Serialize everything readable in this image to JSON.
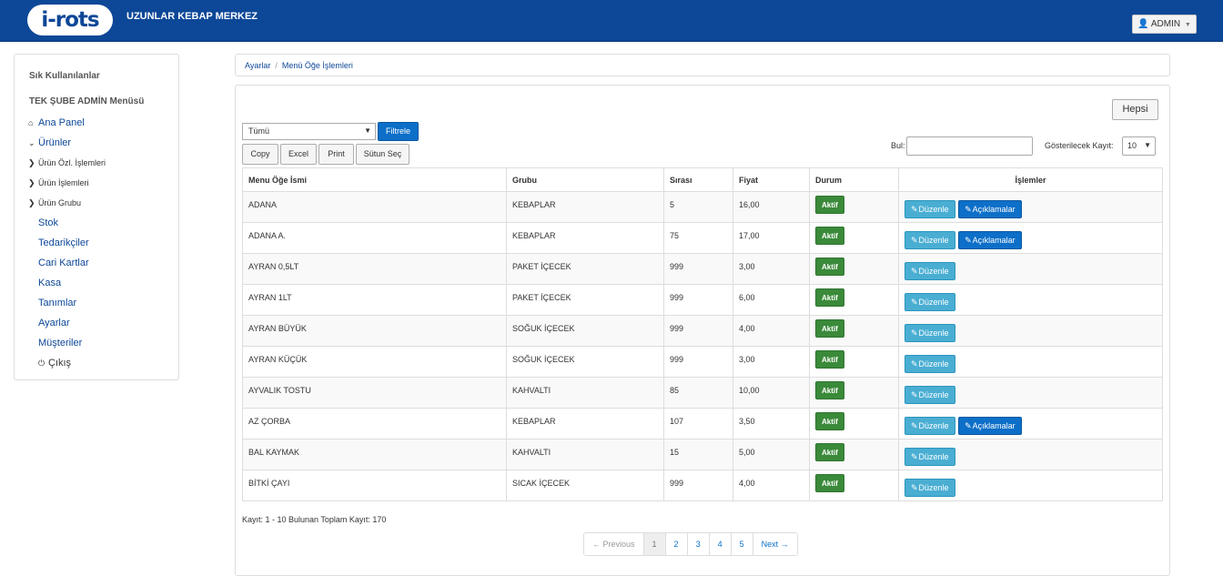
{
  "header": {
    "logo_text": "i-rots",
    "brand": "UZUNLAR KEBAP MERKEZ",
    "user": "ADMIN"
  },
  "sidebar": {
    "section1": "Sık Kullanılanlar",
    "section2": "TEK ŞUBE ADMİN Menüsü",
    "items": [
      {
        "label": "Ana Panel",
        "icon": "home-icon"
      },
      {
        "label": "Ürünler",
        "icon": "chevron-down-icon"
      },
      {
        "label": "Ürün Özl. İşlemleri",
        "icon": "chevron-right-icon"
      },
      {
        "label": "Ürün İşlemleri",
        "icon": "chevron-right-icon"
      },
      {
        "label": "Ürün Grubu",
        "icon": "chevron-right-icon"
      },
      {
        "label": "Stok"
      },
      {
        "label": "Tedarikçiler"
      },
      {
        "label": "Cari Kartlar"
      },
      {
        "label": "Kasa"
      },
      {
        "label": "Tanımlar"
      },
      {
        "label": "Ayarlar"
      },
      {
        "label": "Müşteriler"
      },
      {
        "label": "Çıkış",
        "icon": "power-icon"
      }
    ]
  },
  "breadcrumb": {
    "parent": "Ayarlar",
    "current": "Menü Öğe İşlemleri"
  },
  "toolbar": {
    "all_button": "Hepsi",
    "filter_select": "Tümü",
    "filter_button": "Filtrele",
    "copy": "Copy",
    "excel": "Excel",
    "print": "Print",
    "columns": "Sütun Seç",
    "search_label": "Bul:",
    "search_value": "",
    "show_label": "Gösterilecek Kayıt:",
    "show_value": "10"
  },
  "table": {
    "columns": [
      "Menu Öğe İsmi",
      "Grubu",
      "Sırası",
      "Fiyat",
      "Durum",
      "İşlemler"
    ],
    "edit_label": "Düzenle",
    "desc_label": "Açıklamalar",
    "rows": [
      {
        "name": "ADANA",
        "group": "KEBAPLAR",
        "order": "5",
        "price": "16,00",
        "status": "Aktif",
        "has_desc": true
      },
      {
        "name": "ADANA A.",
        "group": "KEBAPLAR",
        "order": "75",
        "price": "17,00",
        "status": "Aktif",
        "has_desc": true
      },
      {
        "name": "AYRAN 0,5LT",
        "group": "PAKET İÇECEK",
        "order": "999",
        "price": "3,00",
        "status": "Aktif",
        "has_desc": false
      },
      {
        "name": "AYRAN 1LT",
        "group": "PAKET İÇECEK",
        "order": "999",
        "price": "6,00",
        "status": "Aktif",
        "has_desc": false
      },
      {
        "name": "AYRAN BÜYÜK",
        "group": "SOĞUK İÇECEK",
        "order": "999",
        "price": "4,00",
        "status": "Aktif",
        "has_desc": false
      },
      {
        "name": "AYRAN KÜÇÜK",
        "group": "SOĞUK İÇECEK",
        "order": "999",
        "price": "3,00",
        "status": "Aktif",
        "has_desc": false
      },
      {
        "name": "AYVALIK TOSTU",
        "group": "KAHVALTI",
        "order": "85",
        "price": "10,00",
        "status": "Aktif",
        "has_desc": false
      },
      {
        "name": "AZ ÇORBA",
        "group": "KEBAPLAR",
        "order": "107",
        "price": "3,50",
        "status": "Aktif",
        "has_desc": true
      },
      {
        "name": "BAL KAYMAK",
        "group": "KAHVALTI",
        "order": "15",
        "price": "5,00",
        "status": "Aktif",
        "has_desc": false
      },
      {
        "name": "BİTKİ ÇAYI",
        "group": "SICAK İÇECEK",
        "order": "999",
        "price": "4,00",
        "status": "Aktif",
        "has_desc": false
      }
    ]
  },
  "footer": {
    "info": "Kayıt: 1 - 10 Bulunan Toplam Kayıt: 170",
    "pages": [
      "← Previous",
      "1",
      "2",
      "3",
      "4",
      "5",
      "Next →"
    ]
  },
  "colors": {
    "header_bg": "#0d4797",
    "primary": "#0d6fc8",
    "info": "#4aaed3",
    "success": "#3a8a3a"
  }
}
